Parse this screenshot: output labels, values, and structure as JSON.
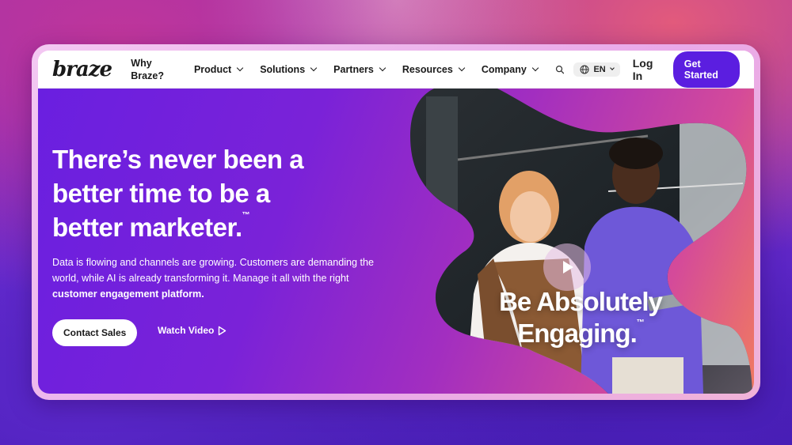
{
  "nav": {
    "logo": "braze",
    "why_line1": "Why",
    "why_line2": "Braze?",
    "items": [
      {
        "label": "Product"
      },
      {
        "label": "Solutions"
      },
      {
        "label": "Partners"
      },
      {
        "label": "Resources"
      },
      {
        "label": "Company"
      }
    ],
    "lang": "EN",
    "login": "Log In",
    "cta": "Get Started"
  },
  "hero": {
    "headline_line1": "There’s never been a",
    "headline_line2": "better time to be a",
    "headline_line3": "better marketer.",
    "headline_tm": "™",
    "desc_main": "Data is flowing and channels are growing. Customers are demanding the world, while AI is already transforming it. Manage it all with the right ",
    "desc_bold": "customer engagement platform.",
    "contact_sales": "Contact Sales",
    "watch_video": "Watch Video",
    "overlay_line1": "Be Absolutely",
    "overlay_line2": "Engaging.",
    "overlay_tm": "™"
  },
  "colors": {
    "brand_purple": "#5b1ee0",
    "hero_start": "#6a1fe0",
    "hero_end": "#f07a60"
  }
}
